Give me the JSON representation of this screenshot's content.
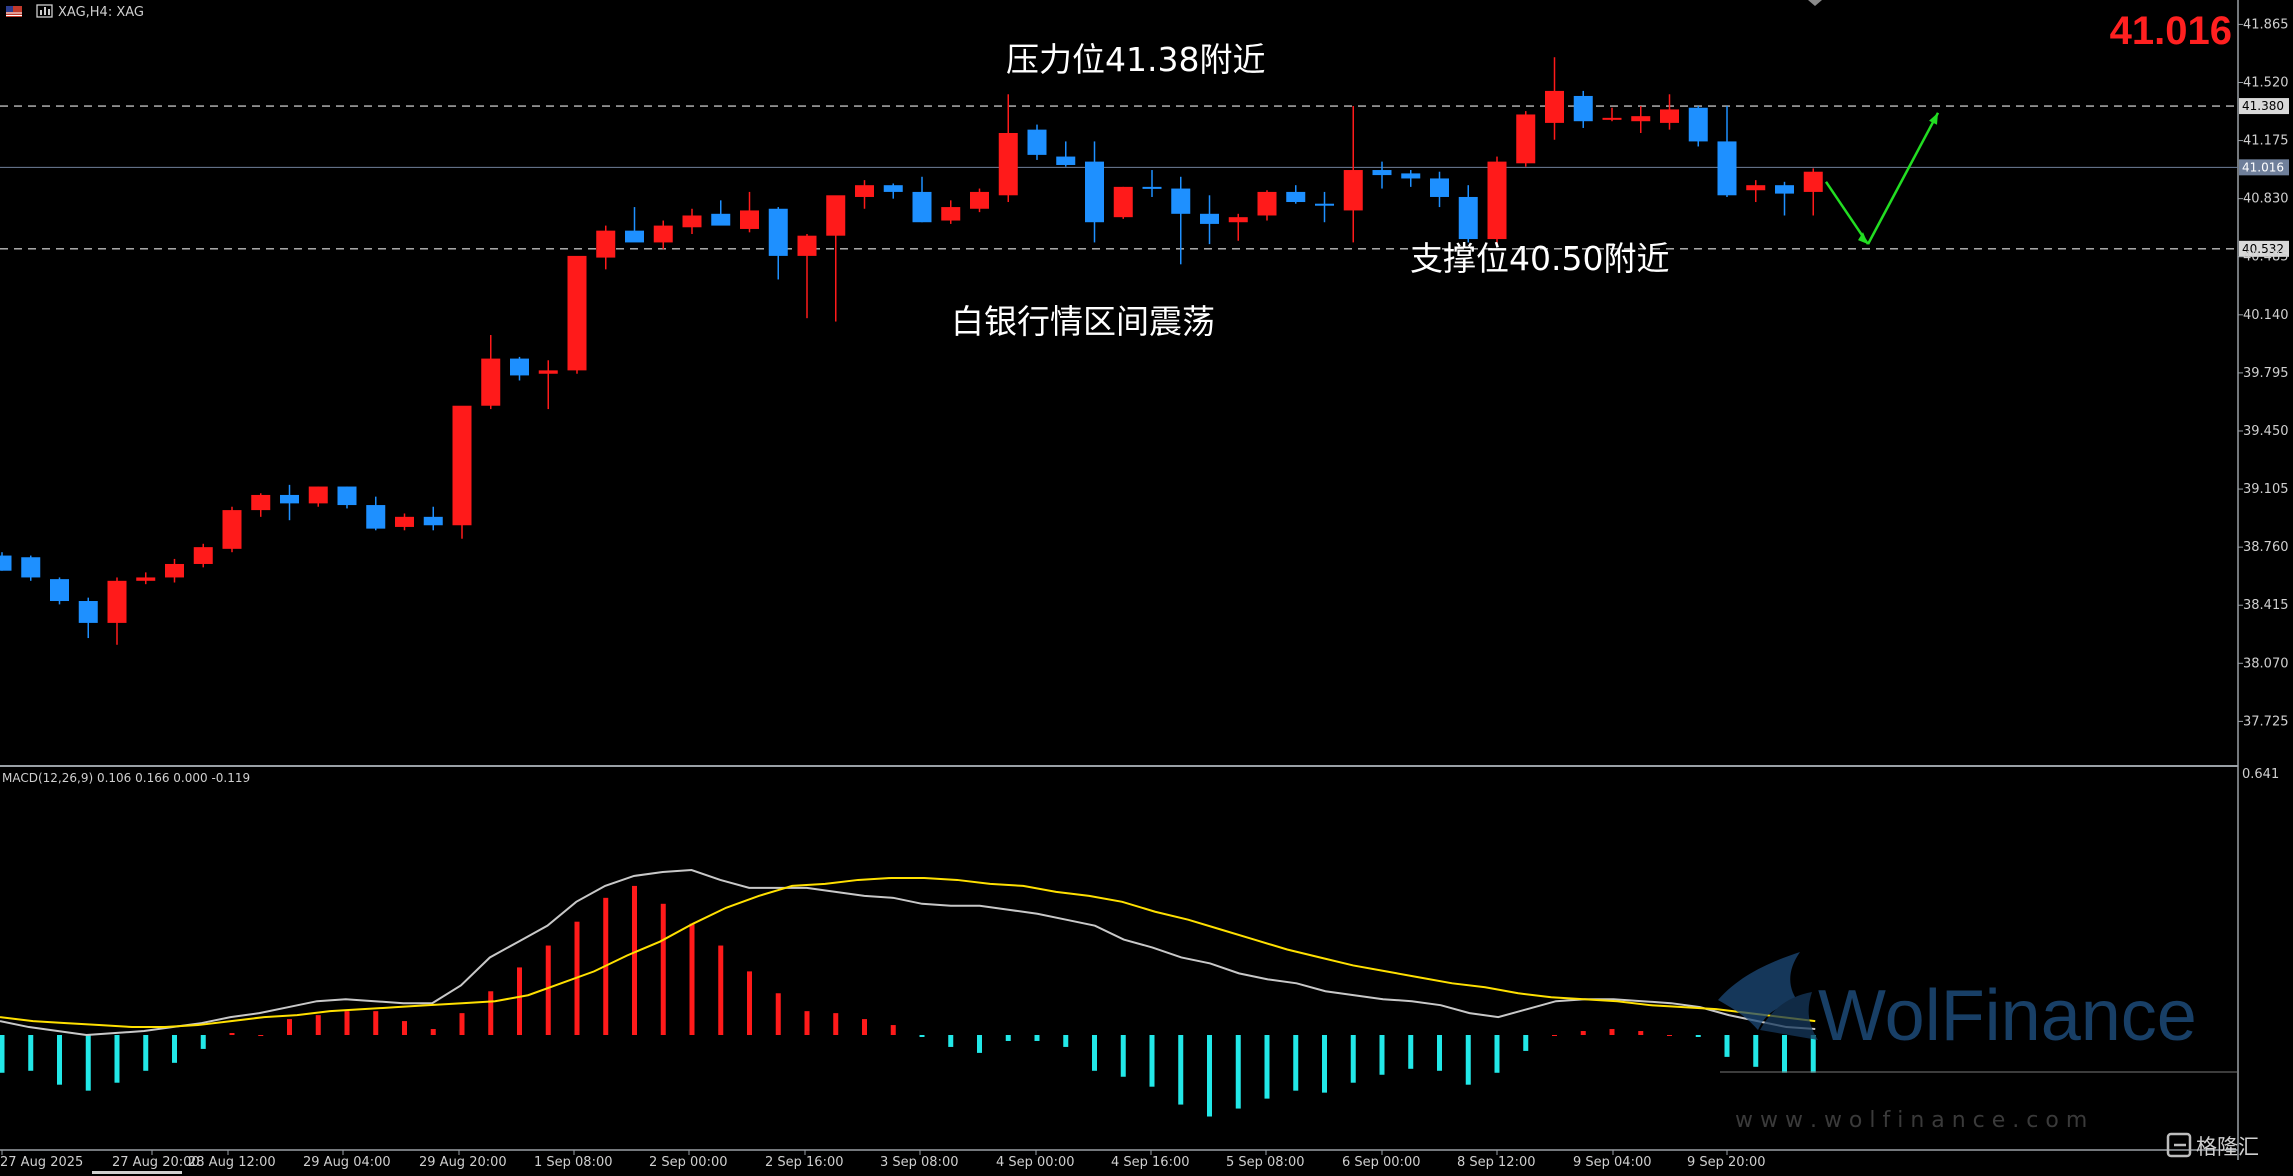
{
  "header": {
    "symbol_title": "XAG,H4: XAG",
    "current_price_big": "41.016"
  },
  "annotations": {
    "resistance": "压力位41.38附近",
    "support": "支撑位40.50附近",
    "range": "白银行情区间震荡"
  },
  "macd": {
    "label": "MACD(12,26,9) 0.106 0.166 0.000 -0.119",
    "axis_top": "0.641"
  },
  "watermark": {
    "brand": "WolFinance",
    "url": "w w w . w o l f i n a n c e . c o m",
    "corner": "格隆汇"
  },
  "colors": {
    "background": "#000000",
    "bull": "#ff1a1a",
    "bear": "#1e90ff",
    "macd_line": "#c8c8c8",
    "signal_line": "#ffe000",
    "hist_pos": "#ff1a1a",
    "hist_neg": "#22e8e8",
    "arrow": "#22dd22"
  },
  "chart_data": {
    "type": "candlestick",
    "title": "XAG,H4",
    "x_tick_labels": [
      "27 Aug 2025",
      "27 Aug 20:00",
      "28 Aug 12:00",
      "29 Aug 04:00",
      "29 Aug 20:00",
      "1 Sep 08:00",
      "2 Sep 00:00",
      "2 Sep 16:00",
      "3 Sep 08:00",
      "4 Sep 00:00",
      "4 Sep 16:00",
      "5 Sep 08:00",
      "6 Sep 00:00",
      "8 Sep 12:00",
      "9 Sep 04:00",
      "9 Sep 20:00"
    ],
    "y_ticks": [
      "41.865",
      "41.520",
      "41.175",
      "40.830",
      "40.485",
      "40.140",
      "39.795",
      "39.450",
      "39.105",
      "38.760",
      "38.415",
      "38.070",
      "37.725"
    ],
    "ylim": [
      37.46,
      42.01
    ],
    "levels": [
      {
        "label": "41.380",
        "value": 41.38,
        "style": "dashed"
      },
      {
        "label": "41.016",
        "value": 41.016,
        "style": "solid"
      },
      {
        "label": "40.532",
        "value": 40.532,
        "style": "dashed"
      }
    ],
    "candles": [
      {
        "o": 38.71,
        "h": 38.73,
        "l": 38.62,
        "c": 38.62
      },
      {
        "o": 38.7,
        "h": 38.71,
        "l": 38.56,
        "c": 38.58
      },
      {
        "o": 38.57,
        "h": 38.58,
        "l": 38.42,
        "c": 38.44
      },
      {
        "o": 38.44,
        "h": 38.46,
        "l": 38.22,
        "c": 38.31
      },
      {
        "o": 38.31,
        "h": 38.58,
        "l": 38.18,
        "c": 38.56
      },
      {
        "o": 38.56,
        "h": 38.61,
        "l": 38.54,
        "c": 38.58
      },
      {
        "o": 38.58,
        "h": 38.69,
        "l": 38.55,
        "c": 38.66
      },
      {
        "o": 38.66,
        "h": 38.78,
        "l": 38.64,
        "c": 38.76
      },
      {
        "o": 38.75,
        "h": 39.0,
        "l": 38.73,
        "c": 38.98
      },
      {
        "o": 38.98,
        "h": 39.08,
        "l": 38.94,
        "c": 39.07
      },
      {
        "o": 39.07,
        "h": 39.13,
        "l": 38.92,
        "c": 39.02
      },
      {
        "o": 39.02,
        "h": 39.12,
        "l": 39.0,
        "c": 39.12
      },
      {
        "o": 39.12,
        "h": 39.12,
        "l": 38.99,
        "c": 39.01
      },
      {
        "o": 39.01,
        "h": 39.06,
        "l": 38.86,
        "c": 38.87
      },
      {
        "o": 38.88,
        "h": 38.96,
        "l": 38.86,
        "c": 38.94
      },
      {
        "o": 38.94,
        "h": 39.0,
        "l": 38.86,
        "c": 38.89
      },
      {
        "o": 38.89,
        "h": 38.92,
        "l": 38.81,
        "c": 39.6
      },
      {
        "o": 39.6,
        "h": 40.02,
        "l": 39.58,
        "c": 39.88
      },
      {
        "o": 39.88,
        "h": 39.89,
        "l": 39.75,
        "c": 39.78
      },
      {
        "o": 39.79,
        "h": 39.87,
        "l": 39.58,
        "c": 39.81
      },
      {
        "o": 39.81,
        "h": 40.48,
        "l": 39.79,
        "c": 40.49
      },
      {
        "o": 40.48,
        "h": 40.67,
        "l": 40.41,
        "c": 40.64
      },
      {
        "o": 40.64,
        "h": 40.78,
        "l": 40.58,
        "c": 40.57
      },
      {
        "o": 40.57,
        "h": 40.7,
        "l": 40.53,
        "c": 40.67
      },
      {
        "o": 40.66,
        "h": 40.77,
        "l": 40.62,
        "c": 40.73
      },
      {
        "o": 40.74,
        "h": 40.82,
        "l": 40.68,
        "c": 40.67
      },
      {
        "o": 40.65,
        "h": 40.87,
        "l": 40.63,
        "c": 40.76
      },
      {
        "o": 40.77,
        "h": 40.78,
        "l": 40.35,
        "c": 40.49
      },
      {
        "o": 40.49,
        "h": 40.62,
        "l": 40.12,
        "c": 40.61
      },
      {
        "o": 40.61,
        "h": 40.81,
        "l": 40.1,
        "c": 40.85
      },
      {
        "o": 40.84,
        "h": 40.94,
        "l": 40.77,
        "c": 40.91
      },
      {
        "o": 40.91,
        "h": 40.92,
        "l": 40.83,
        "c": 40.87
      },
      {
        "o": 40.87,
        "h": 40.96,
        "l": 40.69,
        "c": 40.69
      },
      {
        "o": 40.7,
        "h": 40.82,
        "l": 40.68,
        "c": 40.78
      },
      {
        "o": 40.77,
        "h": 40.89,
        "l": 40.75,
        "c": 40.87
      },
      {
        "o": 40.85,
        "h": 41.45,
        "l": 40.81,
        "c": 41.22
      },
      {
        "o": 41.24,
        "h": 41.27,
        "l": 41.06,
        "c": 41.09
      },
      {
        "o": 41.08,
        "h": 41.17,
        "l": 41.02,
        "c": 41.03
      },
      {
        "o": 41.05,
        "h": 41.17,
        "l": 40.57,
        "c": 40.69
      },
      {
        "o": 40.72,
        "h": 40.9,
        "l": 40.71,
        "c": 40.9
      },
      {
        "o": 40.9,
        "h": 41.0,
        "l": 40.84,
        "c": 40.89
      },
      {
        "o": 40.89,
        "h": 40.96,
        "l": 40.44,
        "c": 40.74
      },
      {
        "o": 40.74,
        "h": 40.85,
        "l": 40.56,
        "c": 40.68
      },
      {
        "o": 40.69,
        "h": 40.74,
        "l": 40.58,
        "c": 40.72
      },
      {
        "o": 40.73,
        "h": 40.88,
        "l": 40.7,
        "c": 40.87
      },
      {
        "o": 40.87,
        "h": 40.91,
        "l": 40.8,
        "c": 40.81
      },
      {
        "o": 40.8,
        "h": 40.87,
        "l": 40.69,
        "c": 40.79
      },
      {
        "o": 40.76,
        "h": 41.38,
        "l": 40.57,
        "c": 41.0
      },
      {
        "o": 41.0,
        "h": 41.05,
        "l": 40.89,
        "c": 40.97
      },
      {
        "o": 40.98,
        "h": 41.0,
        "l": 40.9,
        "c": 40.95
      },
      {
        "o": 40.95,
        "h": 40.99,
        "l": 40.78,
        "c": 40.84
      },
      {
        "o": 40.84,
        "h": 40.91,
        "l": 40.57,
        "c": 40.59
      },
      {
        "o": 40.59,
        "h": 41.08,
        "l": 40.56,
        "c": 41.05
      },
      {
        "o": 41.04,
        "h": 41.35,
        "l": 41.02,
        "c": 41.33
      },
      {
        "o": 41.28,
        "h": 41.67,
        "l": 41.18,
        "c": 41.47
      },
      {
        "o": 41.44,
        "h": 41.47,
        "l": 41.25,
        "c": 41.29
      },
      {
        "o": 41.3,
        "h": 41.37,
        "l": 41.29,
        "c": 41.31
      },
      {
        "o": 41.29,
        "h": 41.38,
        "l": 41.22,
        "c": 41.32
      },
      {
        "o": 41.28,
        "h": 41.45,
        "l": 41.24,
        "c": 41.36
      },
      {
        "o": 41.37,
        "h": 41.38,
        "l": 41.14,
        "c": 41.17
      },
      {
        "o": 41.17,
        "h": 41.38,
        "l": 40.84,
        "c": 40.85
      },
      {
        "o": 40.88,
        "h": 40.94,
        "l": 40.81,
        "c": 40.91
      },
      {
        "o": 40.91,
        "h": 40.93,
        "l": 40.73,
        "c": 40.86
      },
      {
        "o": 40.87,
        "h": 41.01,
        "l": 40.73,
        "c": 40.99
      }
    ],
    "projection": [
      [
        40.92,
        40.93
      ],
      [
        40.96,
        40.56
      ],
      [
        41.0,
        41.34
      ]
    ],
    "macd_hist": [
      -0.19,
      -0.18,
      -0.25,
      -0.28,
      -0.24,
      -0.18,
      -0.14,
      -0.07,
      0.01,
      0.0,
      0.08,
      0.1,
      0.12,
      0.12,
      0.07,
      0.03,
      0.11,
      0.22,
      0.34,
      0.45,
      0.57,
      0.69,
      0.75,
      0.66,
      0.56,
      0.45,
      0.32,
      0.21,
      0.12,
      0.11,
      0.08,
      0.05,
      -0.01,
      -0.06,
      -0.09,
      -0.03,
      -0.03,
      -0.06,
      -0.18,
      -0.21,
      -0.26,
      -0.35,
      -0.41,
      -0.37,
      -0.32,
      -0.28,
      -0.29,
      -0.24,
      -0.2,
      -0.17,
      -0.18,
      -0.25,
      -0.19,
      -0.08,
      0.0,
      0.02,
      0.03,
      0.02,
      0.0,
      -0.01,
      -0.11,
      -0.16,
      -0.19,
      -0.19
    ],
    "macd_line": [
      0.07,
      0.04,
      0.02,
      0.0,
      0.01,
      0.02,
      0.04,
      0.06,
      0.09,
      0.11,
      0.14,
      0.17,
      0.18,
      0.17,
      0.16,
      0.16,
      0.25,
      0.39,
      0.47,
      0.55,
      0.67,
      0.75,
      0.8,
      0.82,
      0.83,
      0.78,
      0.74,
      0.74,
      0.74,
      0.72,
      0.7,
      0.69,
      0.66,
      0.65,
      0.65,
      0.63,
      0.61,
      0.58,
      0.55,
      0.48,
      0.44,
      0.39,
      0.36,
      0.31,
      0.28,
      0.26,
      0.22,
      0.2,
      0.18,
      0.17,
      0.15,
      0.11,
      0.09,
      0.13,
      0.17,
      0.18,
      0.18,
      0.17,
      0.16,
      0.14,
      0.1,
      0.07,
      0.04,
      0.03
    ],
    "signal_line": [
      0.09,
      0.07,
      0.06,
      0.05,
      0.04,
      0.04,
      0.05,
      0.07,
      0.09,
      0.1,
      0.12,
      0.13,
      0.14,
      0.15,
      0.16,
      0.17,
      0.2,
      0.26,
      0.32,
      0.4,
      0.47,
      0.56,
      0.64,
      0.7,
      0.75,
      0.76,
      0.78,
      0.79,
      0.79,
      0.78,
      0.76,
      0.75,
      0.72,
      0.7,
      0.67,
      0.62,
      0.58,
      0.53,
      0.48,
      0.43,
      0.39,
      0.35,
      0.32,
      0.29,
      0.26,
      0.24,
      0.21,
      0.19,
      0.18,
      0.17,
      0.15,
      0.14,
      0.13,
      0.11,
      0.09,
      0.07
    ]
  }
}
